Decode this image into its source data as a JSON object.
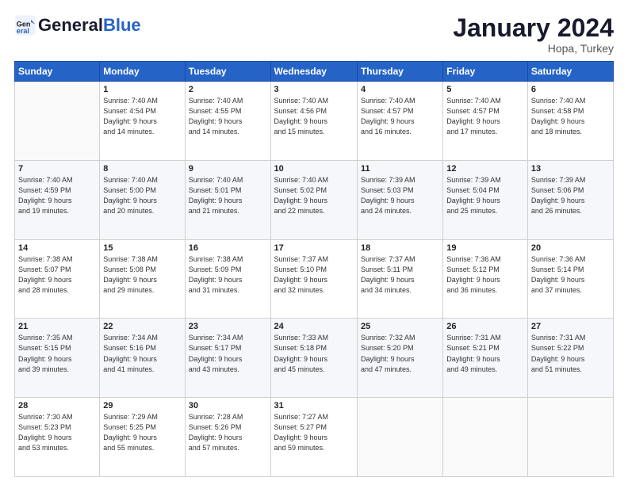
{
  "header": {
    "logo": {
      "line1": "General",
      "line2": "Blue"
    },
    "title": "January 2024",
    "subtitle": "Hopa, Turkey"
  },
  "days_of_week": [
    "Sunday",
    "Monday",
    "Tuesday",
    "Wednesday",
    "Thursday",
    "Friday",
    "Saturday"
  ],
  "weeks": [
    [
      {
        "day": "",
        "sunrise": "",
        "sunset": "",
        "daylight": ""
      },
      {
        "day": "1",
        "sunrise": "7:40 AM",
        "sunset": "4:54 PM",
        "daylight": "9 hours and 14 minutes."
      },
      {
        "day": "2",
        "sunrise": "7:40 AM",
        "sunset": "4:55 PM",
        "daylight": "9 hours and 14 minutes."
      },
      {
        "day": "3",
        "sunrise": "7:40 AM",
        "sunset": "4:56 PM",
        "daylight": "9 hours and 15 minutes."
      },
      {
        "day": "4",
        "sunrise": "7:40 AM",
        "sunset": "4:57 PM",
        "daylight": "9 hours and 16 minutes."
      },
      {
        "day": "5",
        "sunrise": "7:40 AM",
        "sunset": "4:57 PM",
        "daylight": "9 hours and 17 minutes."
      },
      {
        "day": "6",
        "sunrise": "7:40 AM",
        "sunset": "4:58 PM",
        "daylight": "9 hours and 18 minutes."
      }
    ],
    [
      {
        "day": "7",
        "sunrise": "7:40 AM",
        "sunset": "4:59 PM",
        "daylight": "9 hours and 19 minutes."
      },
      {
        "day": "8",
        "sunrise": "7:40 AM",
        "sunset": "5:00 PM",
        "daylight": "9 hours and 20 minutes."
      },
      {
        "day": "9",
        "sunrise": "7:40 AM",
        "sunset": "5:01 PM",
        "daylight": "9 hours and 21 minutes."
      },
      {
        "day": "10",
        "sunrise": "7:40 AM",
        "sunset": "5:02 PM",
        "daylight": "9 hours and 22 minutes."
      },
      {
        "day": "11",
        "sunrise": "7:39 AM",
        "sunset": "5:03 PM",
        "daylight": "9 hours and 24 minutes."
      },
      {
        "day": "12",
        "sunrise": "7:39 AM",
        "sunset": "5:04 PM",
        "daylight": "9 hours and 25 minutes."
      },
      {
        "day": "13",
        "sunrise": "7:39 AM",
        "sunset": "5:06 PM",
        "daylight": "9 hours and 26 minutes."
      }
    ],
    [
      {
        "day": "14",
        "sunrise": "7:38 AM",
        "sunset": "5:07 PM",
        "daylight": "9 hours and 28 minutes."
      },
      {
        "day": "15",
        "sunrise": "7:38 AM",
        "sunset": "5:08 PM",
        "daylight": "9 hours and 29 minutes."
      },
      {
        "day": "16",
        "sunrise": "7:38 AM",
        "sunset": "5:09 PM",
        "daylight": "9 hours and 31 minutes."
      },
      {
        "day": "17",
        "sunrise": "7:37 AM",
        "sunset": "5:10 PM",
        "daylight": "9 hours and 32 minutes."
      },
      {
        "day": "18",
        "sunrise": "7:37 AM",
        "sunset": "5:11 PM",
        "daylight": "9 hours and 34 minutes."
      },
      {
        "day": "19",
        "sunrise": "7:36 AM",
        "sunset": "5:12 PM",
        "daylight": "9 hours and 36 minutes."
      },
      {
        "day": "20",
        "sunrise": "7:36 AM",
        "sunset": "5:14 PM",
        "daylight": "9 hours and 37 minutes."
      }
    ],
    [
      {
        "day": "21",
        "sunrise": "7:35 AM",
        "sunset": "5:15 PM",
        "daylight": "9 hours and 39 minutes."
      },
      {
        "day": "22",
        "sunrise": "7:34 AM",
        "sunset": "5:16 PM",
        "daylight": "9 hours and 41 minutes."
      },
      {
        "day": "23",
        "sunrise": "7:34 AM",
        "sunset": "5:17 PM",
        "daylight": "9 hours and 43 minutes."
      },
      {
        "day": "24",
        "sunrise": "7:33 AM",
        "sunset": "5:18 PM",
        "daylight": "9 hours and 45 minutes."
      },
      {
        "day": "25",
        "sunrise": "7:32 AM",
        "sunset": "5:20 PM",
        "daylight": "9 hours and 47 minutes."
      },
      {
        "day": "26",
        "sunrise": "7:31 AM",
        "sunset": "5:21 PM",
        "daylight": "9 hours and 49 minutes."
      },
      {
        "day": "27",
        "sunrise": "7:31 AM",
        "sunset": "5:22 PM",
        "daylight": "9 hours and 51 minutes."
      }
    ],
    [
      {
        "day": "28",
        "sunrise": "7:30 AM",
        "sunset": "5:23 PM",
        "daylight": "9 hours and 53 minutes."
      },
      {
        "day": "29",
        "sunrise": "7:29 AM",
        "sunset": "5:25 PM",
        "daylight": "9 hours and 55 minutes."
      },
      {
        "day": "30",
        "sunrise": "7:28 AM",
        "sunset": "5:26 PM",
        "daylight": "9 hours and 57 minutes."
      },
      {
        "day": "31",
        "sunrise": "7:27 AM",
        "sunset": "5:27 PM",
        "daylight": "9 hours and 59 minutes."
      },
      {
        "day": "",
        "sunrise": "",
        "sunset": "",
        "daylight": ""
      },
      {
        "day": "",
        "sunrise": "",
        "sunset": "",
        "daylight": ""
      },
      {
        "day": "",
        "sunrise": "",
        "sunset": "",
        "daylight": ""
      }
    ]
  ]
}
